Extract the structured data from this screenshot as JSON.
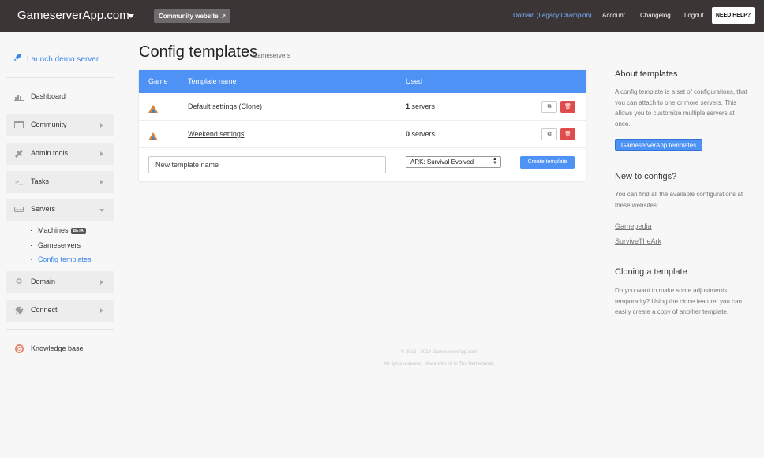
{
  "topbar": {
    "brand": "GameserverApp.com",
    "community_label": "Community website",
    "domain_label": "Domain (Legacy Champion)",
    "account": "Account",
    "changelog": "Changelog",
    "logout": "Logout",
    "help": "NEED HELP?"
  },
  "sidebar": {
    "launch": "Launch demo server",
    "dashboard": "Dashboard",
    "community": "Community",
    "admin_tools": "Admin tools",
    "tasks": "Tasks",
    "servers": "Servers",
    "machines": "Machines",
    "beta": "BETA",
    "gameservers": "Gameservers",
    "config_templates": "Config templates",
    "domain": "Domain",
    "connect": "Connect",
    "knowledge_base": "Knowledge base"
  },
  "main": {
    "title": "Config templates",
    "subtitle": "Gameservers",
    "columns": {
      "game": "Game",
      "name": "Template name",
      "used": "Used"
    },
    "rows": [
      {
        "name": "Default settings (Clone)",
        "used_count": "1",
        "used_unit": "servers"
      },
      {
        "name": "Weekend settings",
        "used_count": "0",
        "used_unit": "servers"
      }
    ],
    "new_placeholder": "New template name",
    "game_select": "ARK: Survival Evolved",
    "create_button": "Create template"
  },
  "footer": {
    "copyright": "© 2016 - 2019 GameserverApp.com",
    "rights": "All rights reserved. Made with <3 in The Netherlands"
  },
  "right_panel": {
    "about_title": "About templates",
    "about_text": "A config template is a set of configurations, that you can attach to one or more servers. This allows you to customize multiple servers at once.",
    "about_button": "GameserverApp templates",
    "new_title": "New to configs?",
    "new_text": "You can find all the available configurations at these websites:",
    "link1": "Gamepedia",
    "link2": "SurviveTheArk",
    "clone_title": "Cloning a template",
    "clone_text": "Do you want to make some adjustments temporarily? Using the clone feature, you can easily create a copy of another template."
  },
  "colors": {
    "topbar": "#3b3536",
    "accent": "#4d92f4",
    "danger": "#e04b4b",
    "link": "#3a86e8"
  }
}
